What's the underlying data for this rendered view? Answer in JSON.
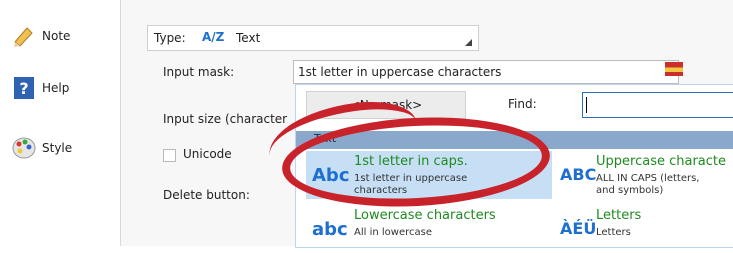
{
  "sidebar": {
    "items": [
      {
        "label": "Note",
        "icon": "pencil-icon"
      },
      {
        "label": "Help",
        "icon": "question-icon"
      },
      {
        "label": "Style",
        "icon": "palette-icon"
      }
    ]
  },
  "form": {
    "type_label": "Type:",
    "type_icon_text": "A/Z",
    "type_value": "Text",
    "input_mask_label": "Input mask:",
    "input_mask_value": "1st letter in uppercase characters",
    "input_size_label": "Input size (character",
    "unicode_label": "Unicode",
    "delete_button_label": "Delete button:"
  },
  "dropdown": {
    "no_mask_label": "<No mask>",
    "find_label": "Find:",
    "find_value": "",
    "category": "Text",
    "options": [
      {
        "glyph": "Abc",
        "title": "1st letter in caps.",
        "desc1": "1st letter in uppercase",
        "desc2": "characters",
        "selected": true
      },
      {
        "glyph": "ABC",
        "title": "Uppercase characte",
        "desc1": "ALL IN CAPS (letters,",
        "desc2": "and symbols)",
        "selected": false
      },
      {
        "glyph": "abc",
        "title": "Lowercase characters",
        "desc1": "All in lowercase",
        "desc2": "",
        "selected": false
      },
      {
        "glyph": "ÀÉÜ",
        "title": "Letters",
        "desc1": "Letters",
        "desc2": "",
        "selected": false
      }
    ]
  },
  "colors": {
    "accent_blue": "#1e6fd0",
    "selected_row": "#c6dff5",
    "category_bar": "#8aa8cc",
    "highlight_ring": "#c8232b",
    "option_title_green": "#1f8a1f"
  }
}
